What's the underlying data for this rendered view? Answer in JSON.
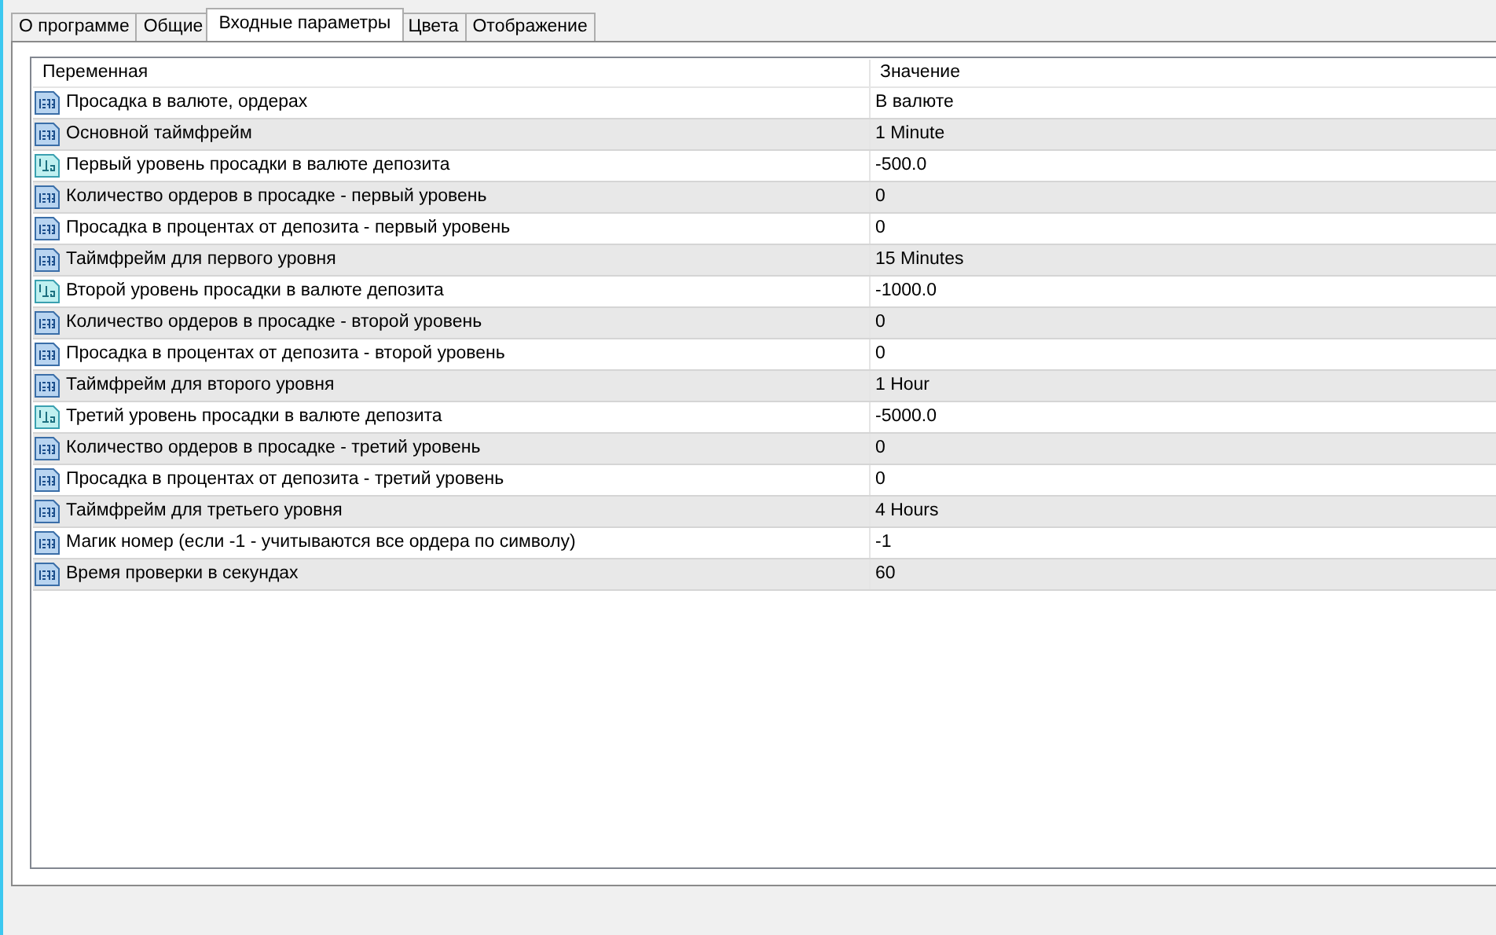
{
  "tabs": [
    {
      "label": "О программе",
      "selected": false
    },
    {
      "label": "Общие",
      "selected": false
    },
    {
      "label": "Входные параметры",
      "selected": true
    },
    {
      "label": "Цвета",
      "selected": false
    },
    {
      "label": "Отображение",
      "selected": false
    }
  ],
  "table": {
    "columns": [
      "Переменная",
      "Значение"
    ],
    "rows": [
      {
        "kind": "integer",
        "variable": "Просадка в валюте, ордерах",
        "value": "В валюте"
      },
      {
        "kind": "integer",
        "variable": "Основной таймфрейм",
        "value": "1 Minute"
      },
      {
        "kind": "double",
        "variable": "Первый уровень просадки в валюте депозита",
        "value": "-500.0"
      },
      {
        "kind": "integer",
        "variable": "Количество ордеров в просадке - первый уровень",
        "value": "0"
      },
      {
        "kind": "integer",
        "variable": "Просадка в процентах от депозита - первый уровень",
        "value": "0"
      },
      {
        "kind": "integer",
        "variable": "Таймфрейм для первого уровня",
        "value": "15 Minutes"
      },
      {
        "kind": "double",
        "variable": "Второй уровень просадки в валюте депозита",
        "value": "-1000.0"
      },
      {
        "kind": "integer",
        "variable": "Количество ордеров в просадке - второй уровень",
        "value": "0"
      },
      {
        "kind": "integer",
        "variable": "Просадка в процентах от депозита - второй уровень",
        "value": "0"
      },
      {
        "kind": "integer",
        "variable": "Таймфрейм для второго уровня",
        "value": "1 Hour"
      },
      {
        "kind": "double",
        "variable": "Третий уровень просадки в валюте депозита",
        "value": "-5000.0"
      },
      {
        "kind": "integer",
        "variable": "Количество ордеров в просадке - третий уровень",
        "value": "0"
      },
      {
        "kind": "integer",
        "variable": "Просадка в процентах от депозита - третий уровень",
        "value": "0"
      },
      {
        "kind": "integer",
        "variable": "Таймфрейм для третьего уровня",
        "value": "4 Hours"
      },
      {
        "kind": "integer",
        "variable": "Магик номер (если -1 - учитываются все ордера по символу)",
        "value": "-1"
      },
      {
        "kind": "integer",
        "variable": "Время проверки в секундах",
        "value": "60"
      }
    ]
  }
}
